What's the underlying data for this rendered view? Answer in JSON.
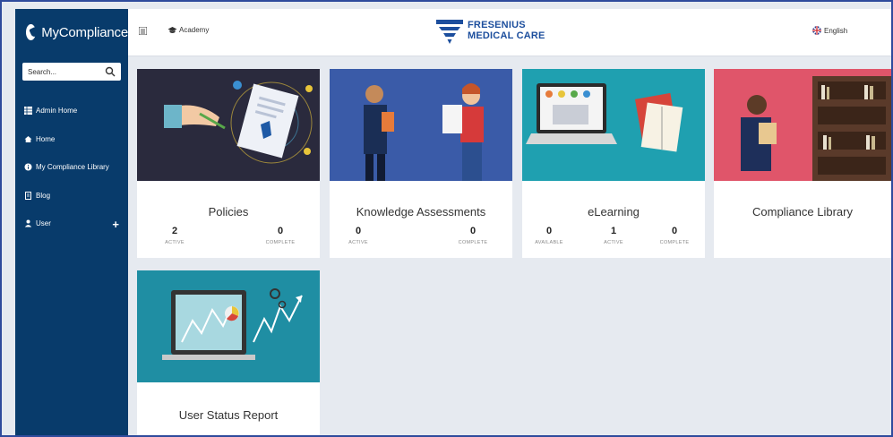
{
  "sidebar": {
    "brand": "MyCompliance",
    "search_placeholder": "Search...",
    "items": [
      {
        "label": "Admin Home",
        "icon": "grid-icon"
      },
      {
        "label": "Home",
        "icon": "home-icon"
      },
      {
        "label": "My Compliance Library",
        "icon": "info-icon"
      },
      {
        "label": "Blog",
        "icon": "document-icon"
      },
      {
        "label": "User",
        "icon": "user-icon"
      }
    ]
  },
  "header": {
    "academy": "Academy",
    "logo_line1": "FRESENIUS",
    "logo_line2": "MEDICAL CARE",
    "language": "English"
  },
  "cards": [
    {
      "title": "Policies",
      "stats": [
        {
          "value": "2",
          "label": "ACTIVE"
        },
        {
          "value": "0",
          "label": "COMPLETE"
        }
      ]
    },
    {
      "title": "Knowledge Assessments",
      "stats": [
        {
          "value": "0",
          "label": "ACTIVE"
        },
        {
          "value": "0",
          "label": "COMPLETE"
        }
      ]
    },
    {
      "title": "eLearning",
      "stats": [
        {
          "value": "0",
          "label": "AVAILABLE"
        },
        {
          "value": "1",
          "label": "ACTIVE"
        },
        {
          "value": "0",
          "label": "COMPLETE"
        }
      ]
    },
    {
      "title": "Compliance Library"
    },
    {
      "title": "User Status Report"
    }
  ],
  "colors": {
    "sidebar": "#083b6b",
    "brand_blue": "#1c4e9d",
    "background": "#e6eaf0"
  }
}
